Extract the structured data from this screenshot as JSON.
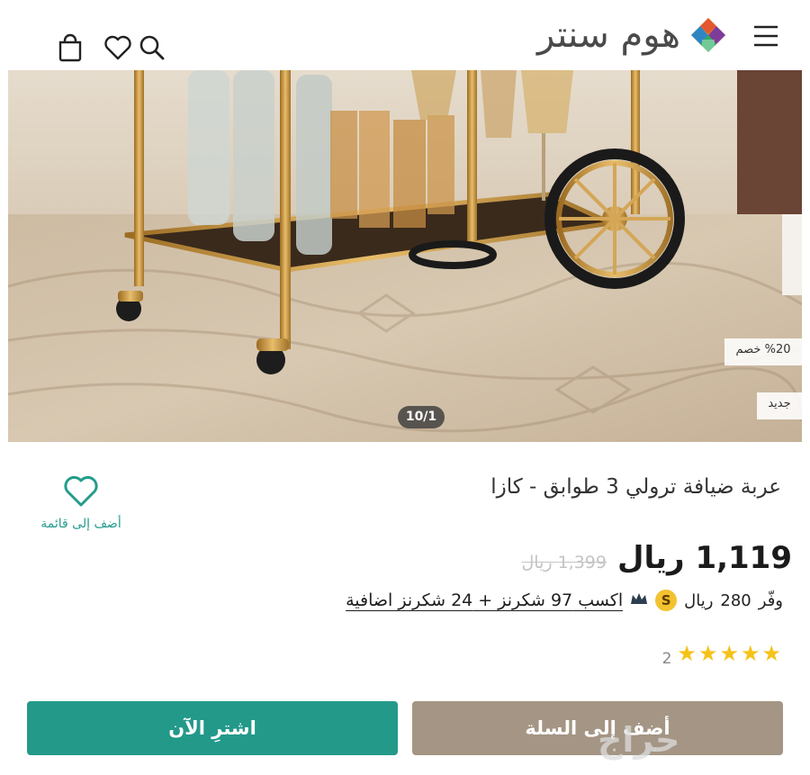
{
  "header": {
    "logo_text": "هوم سنتر",
    "icons": [
      "menu-icon",
      "search-icon",
      "heart-icon",
      "shopping-bag-icon"
    ]
  },
  "gallery": {
    "discount_badge": "%20 خصم",
    "new_badge": "جديد",
    "counter": "10/1"
  },
  "product": {
    "title": "عربة ضيافة ترولي 3 طوابق - كازا",
    "wishlist_label": "أضف إلى قائمة",
    "price_current": "1,119 ريال",
    "price_old": "1,399 ريال",
    "save_label": "وفّر",
    "save_amount": "280",
    "save_currency": "ريال",
    "coin_letter": "S",
    "earn_text": "اكسب 97 شكرنز + 24 شكرنز اضافية",
    "rating_stars": 5,
    "rating_count": "2"
  },
  "actions": {
    "buy_now": "اشترِ الآن",
    "add_to_cart": "أضف إلى السلة"
  },
  "watermark": "حراج",
  "colors": {
    "accent": "#23998a",
    "cart_button": "#a49584",
    "star": "#f6c21a",
    "coin": "#f2c230"
  }
}
